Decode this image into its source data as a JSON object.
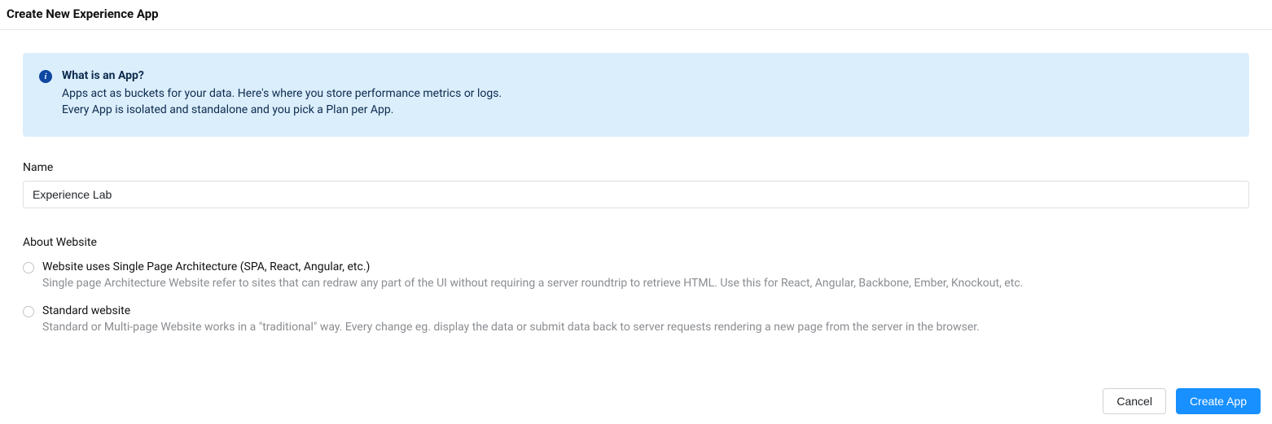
{
  "header": {
    "title": "Create New Experience App"
  },
  "info": {
    "title": "What is an App?",
    "line1": "Apps act as buckets for your data. Here's where you store performance metrics or logs.",
    "line2": "Every App is isolated and standalone and you pick a Plan per App."
  },
  "form": {
    "name_label": "Name",
    "name_value": "Experience Lab",
    "about_label": "About Website",
    "options": [
      {
        "label": "Website uses Single Page Architecture (SPA, React, Angular, etc.)",
        "desc": "Single page Architecture Website refer to sites that can redraw any part of the UI without requiring a server roundtrip to retrieve HTML. Use this for React, Angular, Backbone, Ember, Knockout, etc."
      },
      {
        "label": "Standard website",
        "desc": "Standard or Multi-page Website works in a \"traditional\" way. Every change eg. display the data or submit data back to server requests rendering a new page from the server in the browser."
      }
    ]
  },
  "footer": {
    "cancel_label": "Cancel",
    "create_label": "Create App"
  }
}
